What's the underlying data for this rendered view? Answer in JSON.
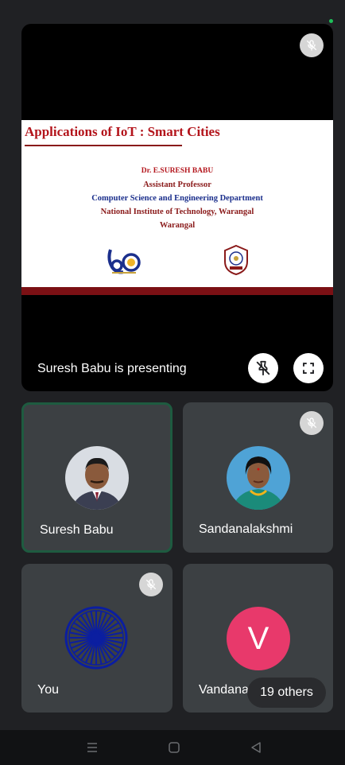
{
  "presentation": {
    "slide": {
      "title": "Applications of IoT : Smart Cities",
      "lines": [
        "Dr. E.SURESH BABU",
        "Assistant Professor",
        "Computer Science and Engineering Department",
        "National Institute of Technology, Warangal",
        "Warangal"
      ]
    },
    "presenting_label": "Suresh Babu is presenting",
    "mic_state": "muted"
  },
  "participants": [
    {
      "name": "Suresh Babu",
      "active_speaker": true,
      "muted": false,
      "avatar": "photo"
    },
    {
      "name": "Sandanalakshmi",
      "active_speaker": false,
      "muted": true,
      "avatar": "photo"
    },
    {
      "name": "You",
      "active_speaker": false,
      "muted": true,
      "avatar": "ashoka-chakra"
    },
    {
      "name": "Vandana",
      "active_speaker": false,
      "muted": false,
      "avatar_letter": "V",
      "avatar_color": "#e8396b"
    }
  ],
  "others_label": "19 others",
  "icons": {
    "mic_off": "mic-off-icon",
    "pin_off": "pin-off-icon",
    "fullscreen": "fullscreen-icon",
    "nav_recents": "recents-icon",
    "nav_home": "home-icon",
    "nav_back": "back-icon"
  },
  "colors": {
    "background": "#202124",
    "tile": "#3c4043",
    "active_border": "#1e5b40",
    "slide_title": "#b3141b"
  }
}
